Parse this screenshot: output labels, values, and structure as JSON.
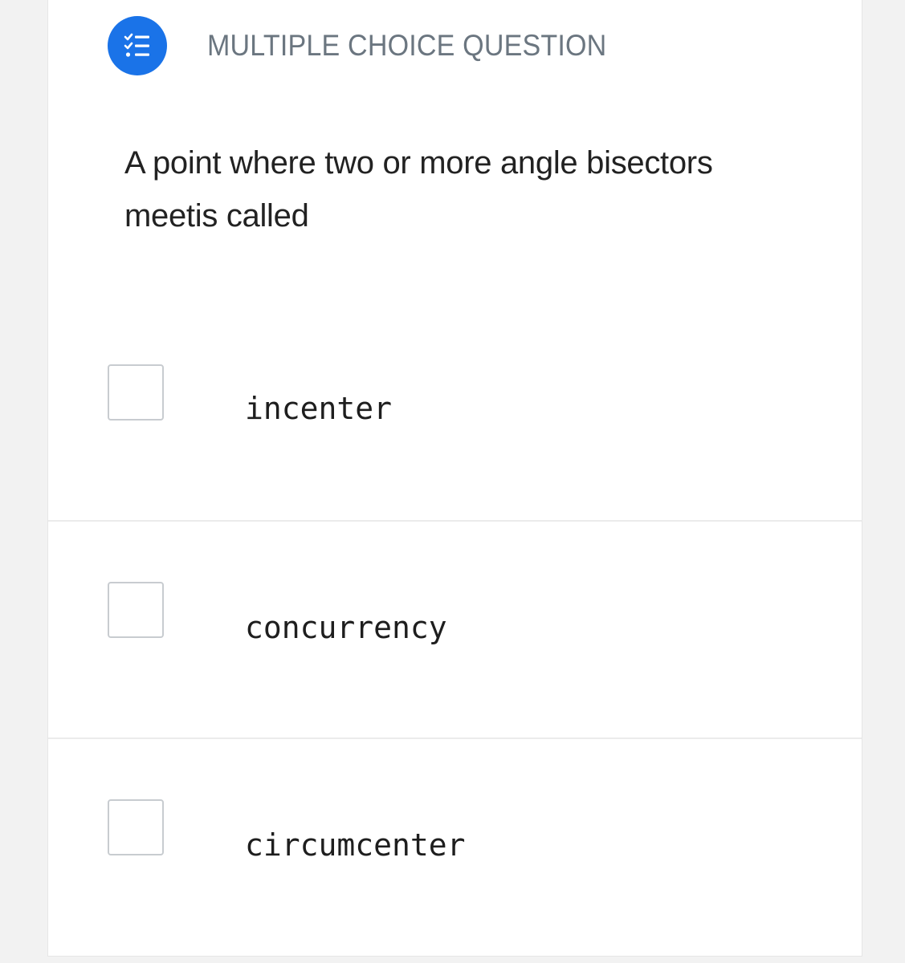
{
  "question_card": {
    "type_label": "MULTIPLE CHOICE QUESTION",
    "type_icon": "checklist-icon",
    "accent_color": "#1a73e8",
    "question_text": "A point where two or more angle bisectors meetis called",
    "options": [
      {
        "label": "incenter",
        "checked": false
      },
      {
        "label": "concurrency",
        "checked": false
      },
      {
        "label": "circumcenter",
        "checked": false
      }
    ]
  }
}
